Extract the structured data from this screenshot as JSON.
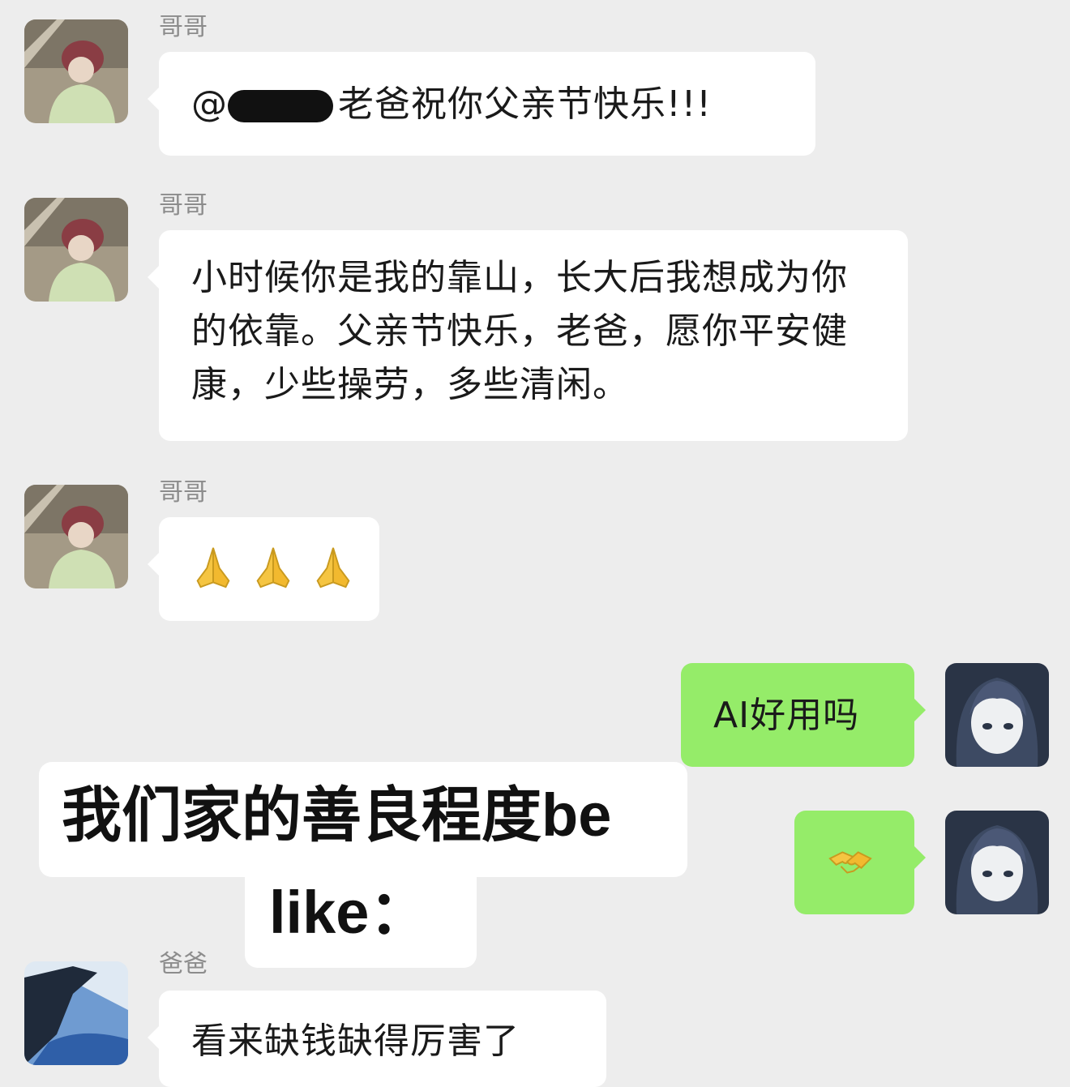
{
  "messages": [
    {
      "sender": "哥哥",
      "text_prefix": "@",
      "text": "老爸祝你父亲节快乐!!!"
    },
    {
      "sender": "哥哥",
      "text": "小时候你是我的靠山，长大后我想成为你的依靠。父亲节快乐，老爸，愿你平安健康，少些操劳，多些清闲。"
    },
    {
      "sender": "哥哥",
      "emoji": [
        "praying-hands",
        "praying-hands",
        "praying-hands"
      ]
    },
    {
      "side": "right",
      "text": "AI好用吗"
    },
    {
      "side": "right",
      "emoji": [
        "handshake"
      ]
    },
    {
      "sender": "爸爸",
      "text": "看来缺钱缺得厉害了"
    }
  ],
  "caption": {
    "line1": "我们家的善良程度be",
    "line2": "like："
  },
  "colors": {
    "background": "#ededed",
    "bubble_left": "#ffffff",
    "bubble_right": "#95ec69",
    "sender_name": "#8c8c8c"
  }
}
